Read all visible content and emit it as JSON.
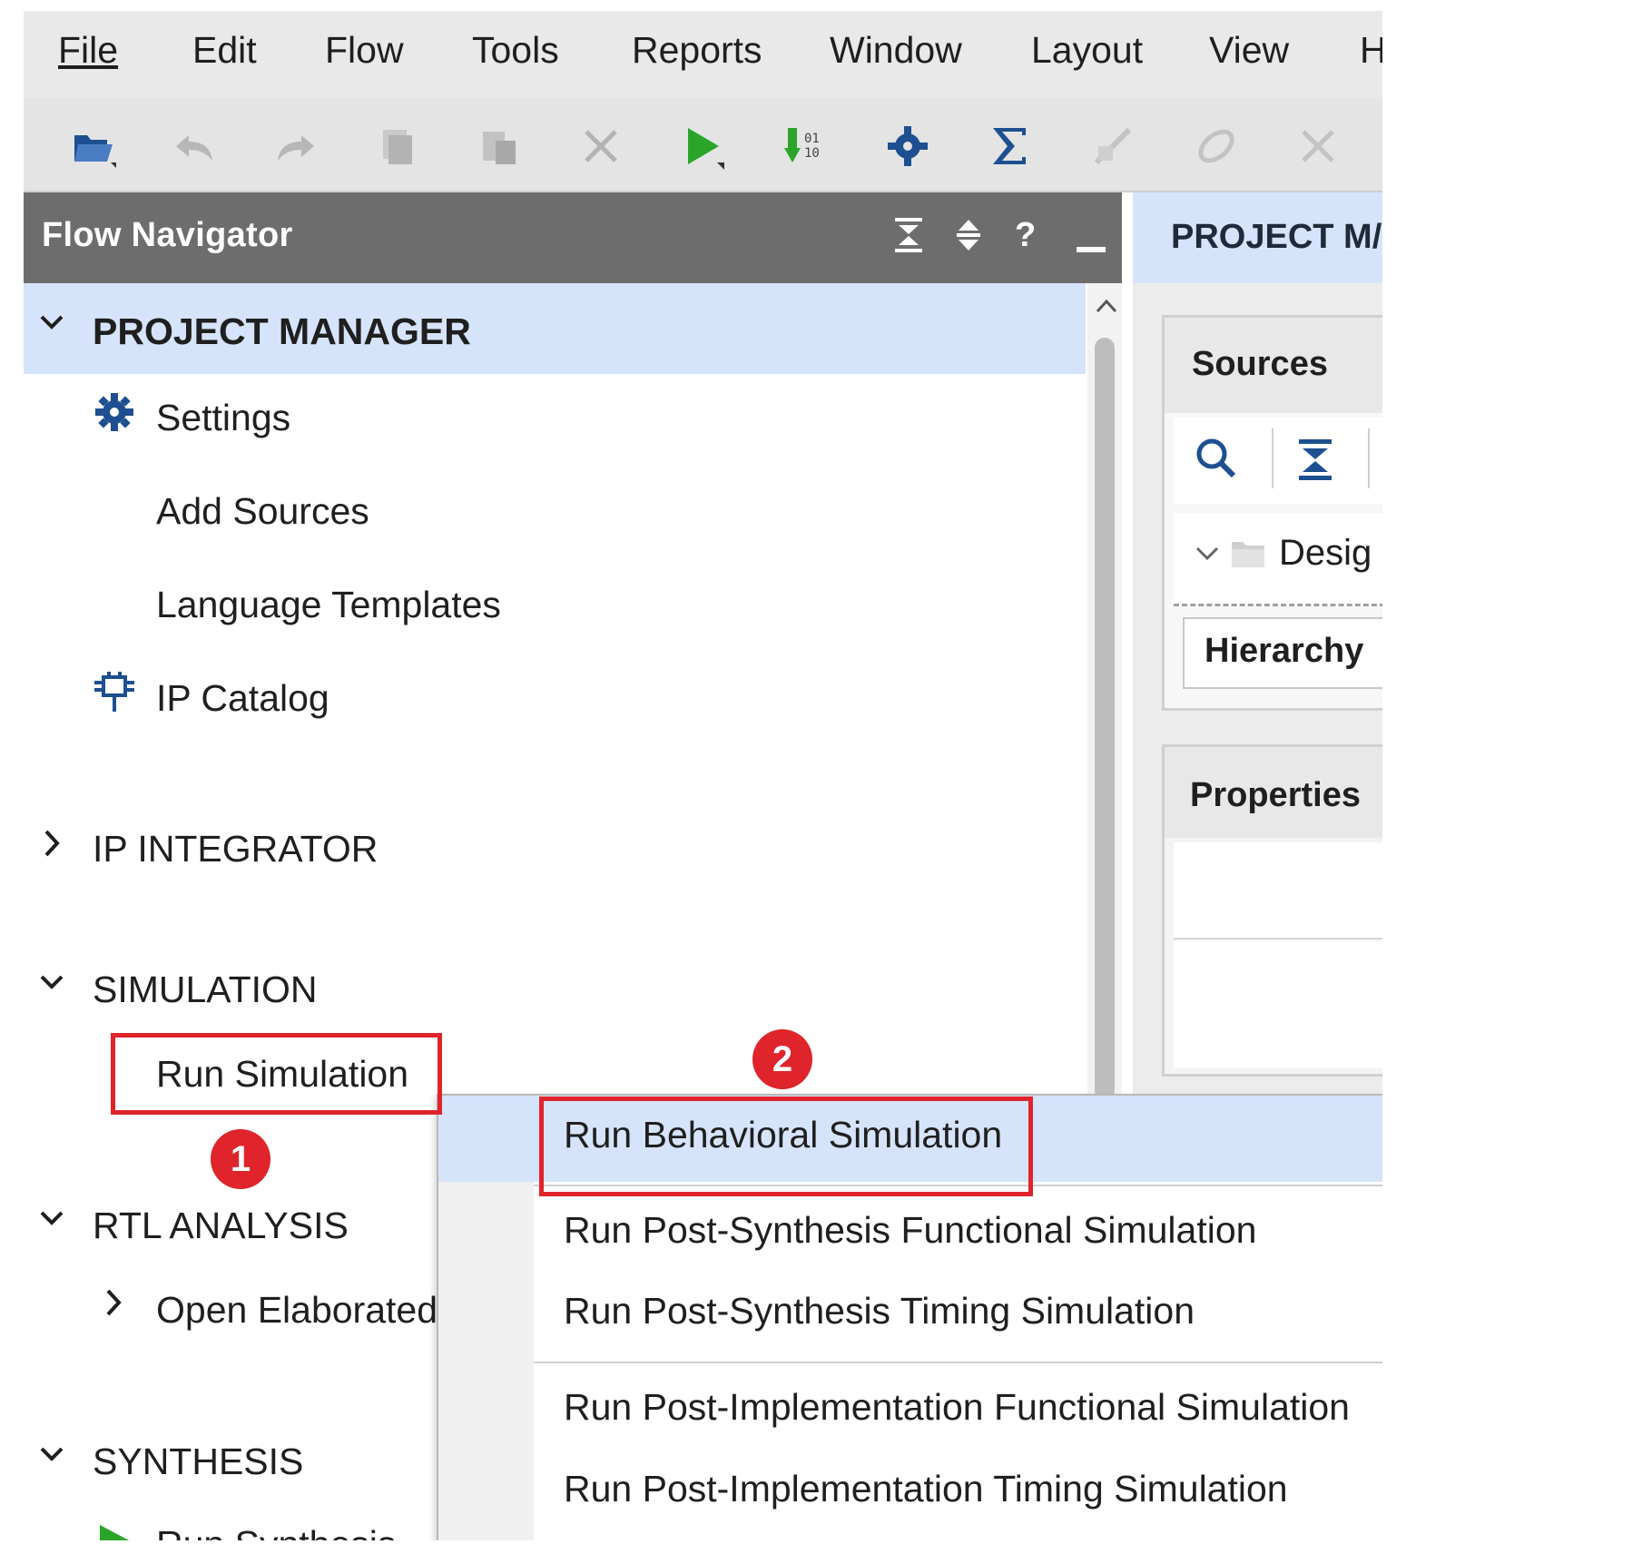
{
  "menu": [
    "File",
    "Edit",
    "Flow",
    "Tools",
    "Reports",
    "Window",
    "Layout",
    "View",
    "H"
  ],
  "toolbar": {
    "icons": [
      "open-project-icon",
      "undo-icon",
      "redo-icon",
      "copy-icon",
      "paste-icon",
      "delete-icon",
      "run-icon",
      "generate-bitstream-icon",
      "settings-icon",
      "report-sum-icon",
      "tool-1-icon",
      "tool-2-icon",
      "tool-3-icon"
    ]
  },
  "flow_navigator": {
    "title": "Flow Navigator",
    "help_icon": "?",
    "sections": {
      "project_manager": {
        "title": "PROJECT MANAGER",
        "items": [
          "Settings",
          "Add Sources",
          "Language Templates",
          "IP Catalog"
        ]
      },
      "ip_integrator": {
        "title": "IP INTEGRATOR"
      },
      "simulation": {
        "title": "SIMULATION",
        "items": [
          "Run Simulation"
        ]
      },
      "rtl_analysis": {
        "title": "RTL ANALYSIS",
        "items": [
          "Open Elaborated"
        ]
      },
      "synthesis": {
        "title": "SYNTHESIS",
        "items": [
          "Run Synthesis"
        ]
      }
    }
  },
  "project_panel": {
    "header": "PROJECT M/",
    "sources": {
      "title": "Sources",
      "tree_item": "Desig",
      "tab": "Hierarchy"
    },
    "properties": {
      "title": "Properties"
    }
  },
  "context_menu": {
    "items": [
      "Run Behavioral Simulation",
      "Run Post-Synthesis Functional Simulation",
      "Run Post-Synthesis Timing Simulation",
      "Run Post-Implementation Functional Simulation",
      "Run Post-Implementation Timing Simulation"
    ]
  },
  "annotations": {
    "badge1": "1",
    "badge2": "2"
  },
  "colors": {
    "accent_highlight": "#d6e4fb",
    "header_gray": "#6d6d6d",
    "annotation_red": "#e0242b",
    "run_green": "#2aa52a",
    "icon_blue": "#1d4f91"
  }
}
